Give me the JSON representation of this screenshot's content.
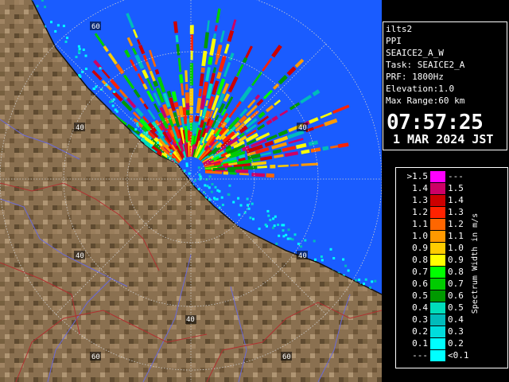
{
  "map": {
    "range_rings": [
      {
        "label": "60"
      },
      {
        "label": "40"
      },
      {
        "label": "40"
      },
      {
        "label": "40"
      },
      {
        "label": "40"
      },
      {
        "label": "60"
      },
      {
        "label": "60"
      }
    ]
  },
  "info": {
    "lines": [
      "ilts2",
      "PPI",
      "SEAICE2_A_W",
      "Task: SEAICE2_A",
      "PRF: 1800Hz",
      "Elevation:1.0",
      "Max Range:60 km"
    ],
    "time": "07:57:25",
    "date": "1 MAR 2024 JST"
  },
  "legend": {
    "title": "Spectrum Width in m/s",
    "rows": [
      {
        "low": ">1.5",
        "high": "---",
        "color": "#ff00ff"
      },
      {
        "low": "1.4",
        "high": "1.5",
        "color": "#cc0066"
      },
      {
        "low": "1.3",
        "high": "1.4",
        "color": "#cc0000"
      },
      {
        "low": "1.2",
        "high": "1.3",
        "color": "#ff2200"
      },
      {
        "low": "1.1",
        "high": "1.2",
        "color": "#ff6600"
      },
      {
        "low": "1.0",
        "high": "1.1",
        "color": "#ff9900"
      },
      {
        "low": "0.9",
        "high": "1.0",
        "color": "#ffcc00"
      },
      {
        "low": "0.8",
        "high": "0.9",
        "color": "#ffff00"
      },
      {
        "low": "0.7",
        "high": "0.8",
        "color": "#00ff00"
      },
      {
        "low": "0.6",
        "high": "0.7",
        "color": "#00cc00"
      },
      {
        "low": "0.5",
        "high": "0.6",
        "color": "#009900"
      },
      {
        "low": "0.4",
        "high": "0.5",
        "color": "#00ddbb"
      },
      {
        "low": "0.3",
        "high": "0.4",
        "color": "#00bbbb"
      },
      {
        "low": "0.2",
        "high": "0.3",
        "color": "#00dddd"
      },
      {
        "low": "0.1",
        "high": "0.2",
        "color": "#00ffff"
      },
      {
        "low": "---",
        "high": "<0.1",
        "color": "#00ffff"
      }
    ]
  }
}
